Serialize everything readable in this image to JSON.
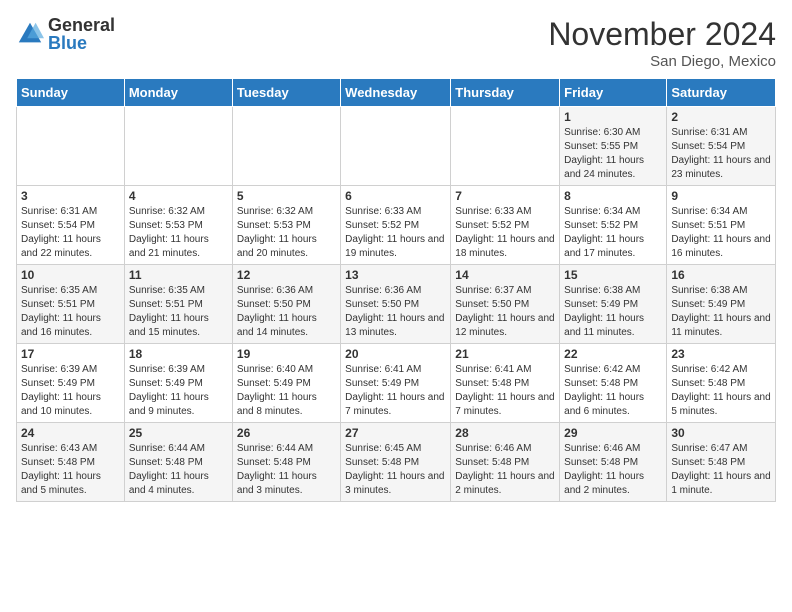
{
  "logo": {
    "general": "General",
    "blue": "Blue"
  },
  "title": "November 2024",
  "location": "San Diego, Mexico",
  "days_of_week": [
    "Sunday",
    "Monday",
    "Tuesday",
    "Wednesday",
    "Thursday",
    "Friday",
    "Saturday"
  ],
  "weeks": [
    [
      {
        "day": "",
        "info": ""
      },
      {
        "day": "",
        "info": ""
      },
      {
        "day": "",
        "info": ""
      },
      {
        "day": "",
        "info": ""
      },
      {
        "day": "",
        "info": ""
      },
      {
        "day": "1",
        "info": "Sunrise: 6:30 AM\nSunset: 5:55 PM\nDaylight: 11 hours and 24 minutes."
      },
      {
        "day": "2",
        "info": "Sunrise: 6:31 AM\nSunset: 5:54 PM\nDaylight: 11 hours and 23 minutes."
      }
    ],
    [
      {
        "day": "3",
        "info": "Sunrise: 6:31 AM\nSunset: 5:54 PM\nDaylight: 11 hours and 22 minutes."
      },
      {
        "day": "4",
        "info": "Sunrise: 6:32 AM\nSunset: 5:53 PM\nDaylight: 11 hours and 21 minutes."
      },
      {
        "day": "5",
        "info": "Sunrise: 6:32 AM\nSunset: 5:53 PM\nDaylight: 11 hours and 20 minutes."
      },
      {
        "day": "6",
        "info": "Sunrise: 6:33 AM\nSunset: 5:52 PM\nDaylight: 11 hours and 19 minutes."
      },
      {
        "day": "7",
        "info": "Sunrise: 6:33 AM\nSunset: 5:52 PM\nDaylight: 11 hours and 18 minutes."
      },
      {
        "day": "8",
        "info": "Sunrise: 6:34 AM\nSunset: 5:52 PM\nDaylight: 11 hours and 17 minutes."
      },
      {
        "day": "9",
        "info": "Sunrise: 6:34 AM\nSunset: 5:51 PM\nDaylight: 11 hours and 16 minutes."
      }
    ],
    [
      {
        "day": "10",
        "info": "Sunrise: 6:35 AM\nSunset: 5:51 PM\nDaylight: 11 hours and 16 minutes."
      },
      {
        "day": "11",
        "info": "Sunrise: 6:35 AM\nSunset: 5:51 PM\nDaylight: 11 hours and 15 minutes."
      },
      {
        "day": "12",
        "info": "Sunrise: 6:36 AM\nSunset: 5:50 PM\nDaylight: 11 hours and 14 minutes."
      },
      {
        "day": "13",
        "info": "Sunrise: 6:36 AM\nSunset: 5:50 PM\nDaylight: 11 hours and 13 minutes."
      },
      {
        "day": "14",
        "info": "Sunrise: 6:37 AM\nSunset: 5:50 PM\nDaylight: 11 hours and 12 minutes."
      },
      {
        "day": "15",
        "info": "Sunrise: 6:38 AM\nSunset: 5:49 PM\nDaylight: 11 hours and 11 minutes."
      },
      {
        "day": "16",
        "info": "Sunrise: 6:38 AM\nSunset: 5:49 PM\nDaylight: 11 hours and 11 minutes."
      }
    ],
    [
      {
        "day": "17",
        "info": "Sunrise: 6:39 AM\nSunset: 5:49 PM\nDaylight: 11 hours and 10 minutes."
      },
      {
        "day": "18",
        "info": "Sunrise: 6:39 AM\nSunset: 5:49 PM\nDaylight: 11 hours and 9 minutes."
      },
      {
        "day": "19",
        "info": "Sunrise: 6:40 AM\nSunset: 5:49 PM\nDaylight: 11 hours and 8 minutes."
      },
      {
        "day": "20",
        "info": "Sunrise: 6:41 AM\nSunset: 5:49 PM\nDaylight: 11 hours and 7 minutes."
      },
      {
        "day": "21",
        "info": "Sunrise: 6:41 AM\nSunset: 5:48 PM\nDaylight: 11 hours and 7 minutes."
      },
      {
        "day": "22",
        "info": "Sunrise: 6:42 AM\nSunset: 5:48 PM\nDaylight: 11 hours and 6 minutes."
      },
      {
        "day": "23",
        "info": "Sunrise: 6:42 AM\nSunset: 5:48 PM\nDaylight: 11 hours and 5 minutes."
      }
    ],
    [
      {
        "day": "24",
        "info": "Sunrise: 6:43 AM\nSunset: 5:48 PM\nDaylight: 11 hours and 5 minutes."
      },
      {
        "day": "25",
        "info": "Sunrise: 6:44 AM\nSunset: 5:48 PM\nDaylight: 11 hours and 4 minutes."
      },
      {
        "day": "26",
        "info": "Sunrise: 6:44 AM\nSunset: 5:48 PM\nDaylight: 11 hours and 3 minutes."
      },
      {
        "day": "27",
        "info": "Sunrise: 6:45 AM\nSunset: 5:48 PM\nDaylight: 11 hours and 3 minutes."
      },
      {
        "day": "28",
        "info": "Sunrise: 6:46 AM\nSunset: 5:48 PM\nDaylight: 11 hours and 2 minutes."
      },
      {
        "day": "29",
        "info": "Sunrise: 6:46 AM\nSunset: 5:48 PM\nDaylight: 11 hours and 2 minutes."
      },
      {
        "day": "30",
        "info": "Sunrise: 6:47 AM\nSunset: 5:48 PM\nDaylight: 11 hours and 1 minute."
      }
    ]
  ]
}
